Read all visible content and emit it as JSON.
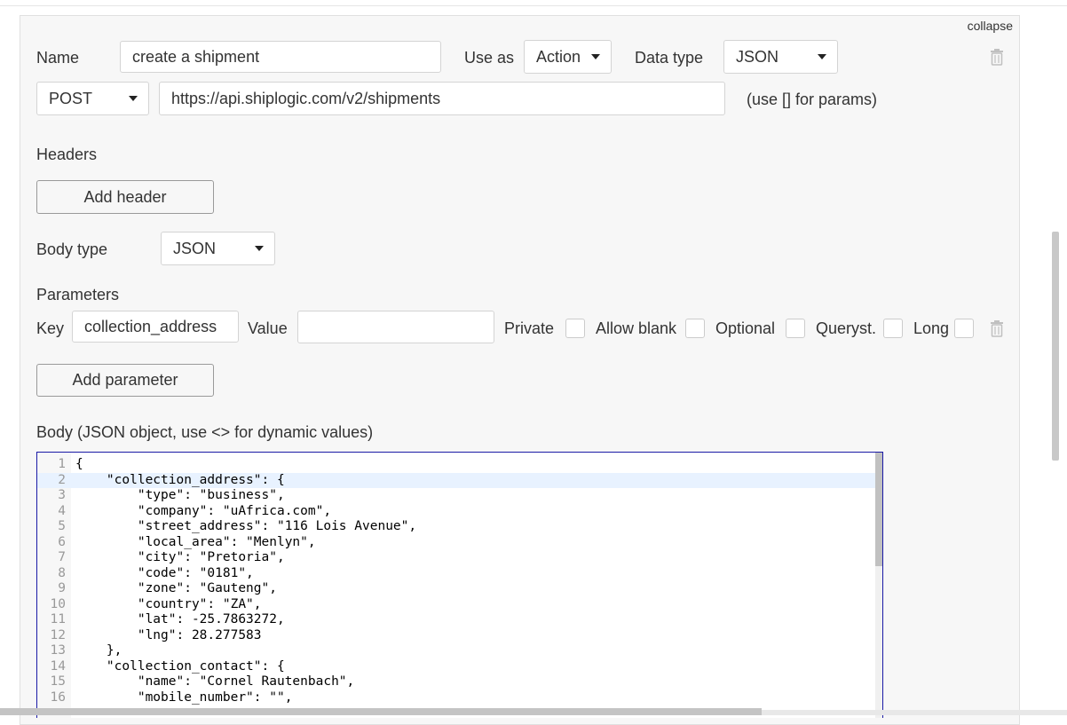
{
  "collapse_label": "collapse",
  "call": {
    "name_label": "Name",
    "name_value": "create a shipment",
    "use_as_label": "Use as",
    "use_as_value": "Action",
    "data_type_label": "Data type",
    "data_type_value": "JSON",
    "method_value": "POST",
    "url_value": "https://api.shiplogic.com/v2/shipments",
    "params_hint": "(use [] for params)"
  },
  "headers": {
    "title": "Headers",
    "add_label": "Add header"
  },
  "body_type": {
    "label": "Body type",
    "value": "JSON"
  },
  "parameters": {
    "title": "Parameters",
    "key_label": "Key",
    "key_value": "collection_address",
    "value_label": "Value",
    "value_value": "",
    "private_label": "Private",
    "private_checked": false,
    "allow_blank_label": "Allow blank",
    "allow_blank_checked": false,
    "optional_label": "Optional",
    "optional_checked": false,
    "queryst_label": "Queryst.",
    "queryst_checked": false,
    "long_label": "Long",
    "long_checked": false,
    "add_label": "Add parameter"
  },
  "body": {
    "label": "Body (JSON object, use <> for dynamic values)",
    "active_line": 2,
    "lines": [
      {
        "n": "1",
        "t": "{"
      },
      {
        "n": "2",
        "t": "    \"collection_address\": {"
      },
      {
        "n": "3",
        "t": "        \"type\": \"business\","
      },
      {
        "n": "4",
        "t": "        \"company\": \"uAfrica.com\","
      },
      {
        "n": "5",
        "t": "        \"street_address\": \"116 Lois Avenue\","
      },
      {
        "n": "6",
        "t": "        \"local_area\": \"Menlyn\","
      },
      {
        "n": "7",
        "t": "        \"city\": \"Pretoria\","
      },
      {
        "n": "8",
        "t": "        \"code\": \"0181\","
      },
      {
        "n": "9",
        "t": "        \"zone\": \"Gauteng\","
      },
      {
        "n": "10",
        "t": "        \"country\": \"ZA\","
      },
      {
        "n": "11",
        "t": "        \"lat\": -25.7863272,"
      },
      {
        "n": "12",
        "t": "        \"lng\": 28.277583"
      },
      {
        "n": "13",
        "t": "    },"
      },
      {
        "n": "14",
        "t": "    \"collection_contact\": {"
      },
      {
        "n": "15",
        "t": "        \"name\": \"Cornel Rautenbach\","
      },
      {
        "n": "16",
        "t": "        \"mobile_number\": \"\","
      }
    ]
  },
  "icons": {
    "trash": "trash-icon",
    "caret": "caret-down-icon"
  }
}
